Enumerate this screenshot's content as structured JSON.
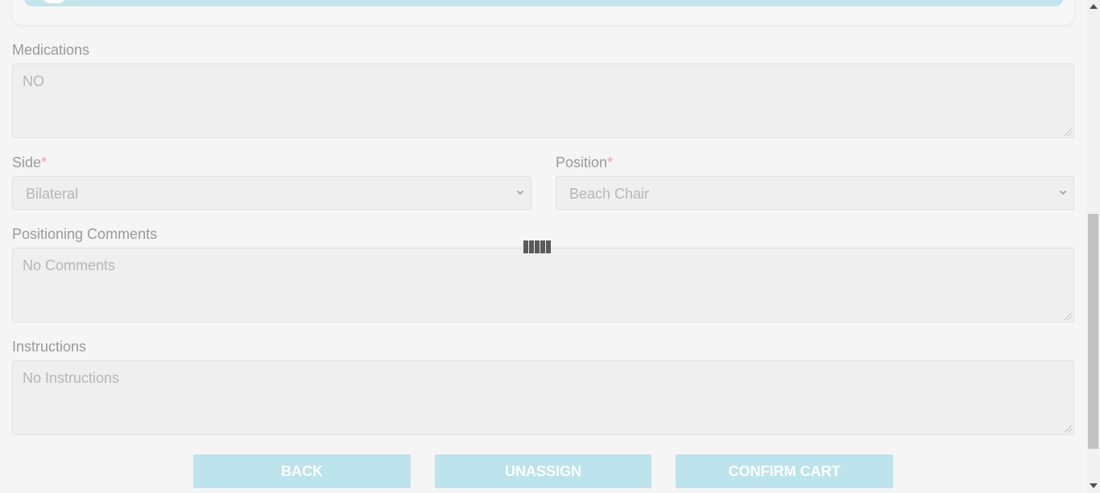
{
  "form": {
    "medications": {
      "label": "Medications",
      "value": "NO"
    },
    "side": {
      "label": "Side",
      "required_mark": "*",
      "value": "Bilateral"
    },
    "position": {
      "label": "Position",
      "required_mark": "*",
      "value": "Beach Chair"
    },
    "positioning_comments": {
      "label": "Positioning Comments",
      "value": "No Comments"
    },
    "instructions": {
      "label": "Instructions",
      "value": "No Instructions"
    }
  },
  "actions": {
    "back_label": "BACK",
    "unassign_label": "UNASSIGN",
    "confirm_cart_label": "CONFIRM CART"
  },
  "colors": {
    "button_bg": "#bde3ec",
    "label_text": "#9a9a9a",
    "required": "#e8a3a3"
  },
  "icons": {
    "loader": "loading-spinner-icon",
    "select_chevron": "chevron-down-icon"
  }
}
